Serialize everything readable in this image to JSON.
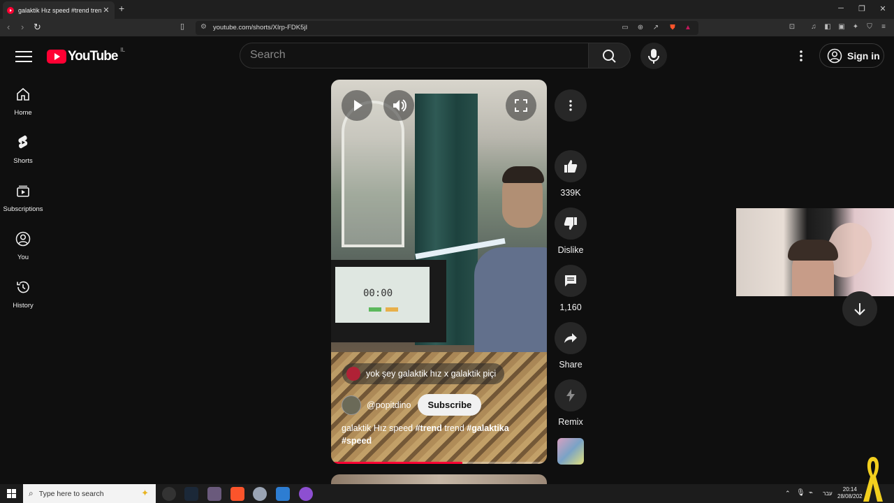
{
  "browser": {
    "tab_title": "galaktik Hız speed #trend trend",
    "url": "youtube.com/shorts/XIrp-FDK5jI"
  },
  "header": {
    "logo_text": "YouTube",
    "country_code": "IL",
    "search_placeholder": "Search",
    "signin_label": "Sign in"
  },
  "sidebar": {
    "items": [
      {
        "label": "Home",
        "icon": "home-icon"
      },
      {
        "label": "Shorts",
        "icon": "shorts-icon"
      },
      {
        "label": "Subscriptions",
        "icon": "subscriptions-icon"
      },
      {
        "label": "You",
        "icon": "account-icon"
      },
      {
        "label": "History",
        "icon": "history-icon"
      }
    ]
  },
  "video": {
    "timer_display": "00:00",
    "music": "yok şey galaktik hız x galaktik piçi",
    "channel": "@popitdino",
    "subscribe_label": "Subscribe",
    "caption_plain1": "galaktik Hız speed ",
    "caption_tag1": "#trend",
    "caption_plain2": " trend ",
    "caption_tag2": "#galaktika",
    "caption_tag3": "#speed",
    "progress": 0.61
  },
  "actions": {
    "likes": "339K",
    "dislike_label": "Dislike",
    "comments": "1,160",
    "share_label": "Share",
    "remix_label": "Remix"
  },
  "taskbar": {
    "search_placeholder": "Type here to search",
    "language": "עבר",
    "time": "20:14",
    "date": "28/08/202"
  },
  "colors": {
    "accent": "#ff0033",
    "background": "#0f0f0f",
    "chip": "#272727"
  }
}
